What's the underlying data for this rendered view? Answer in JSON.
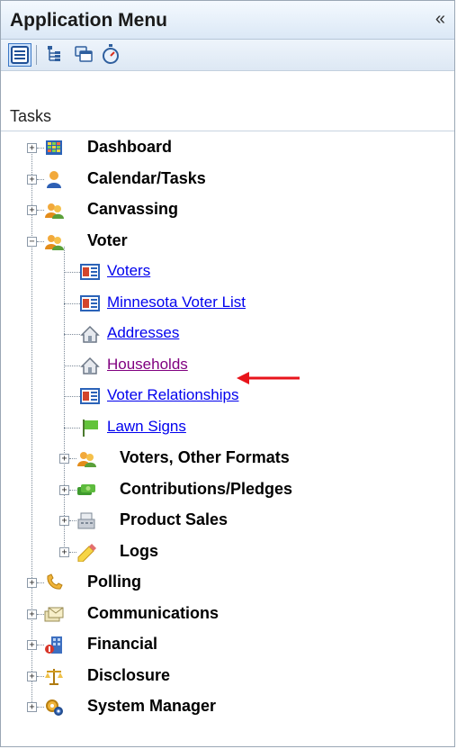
{
  "header": {
    "title": "Application Menu",
    "collapse_glyph": "«"
  },
  "toolbar": {
    "buttons": [
      {
        "icon": "list-view-icon",
        "active": true
      },
      {
        "icon": "tree-view-icon",
        "active": false
      },
      {
        "icon": "windows-icon",
        "active": false
      },
      {
        "icon": "stopwatch-icon",
        "active": false
      }
    ]
  },
  "tasks_label": "Tasks",
  "tree": {
    "items": [
      {
        "label": "Dashboard",
        "icon": "dashboard-icon",
        "level": 0,
        "expanded": false
      },
      {
        "label": "Calendar/Tasks",
        "icon": "person-icon",
        "level": 0,
        "expanded": false
      },
      {
        "label": "Canvassing",
        "icon": "people-icon",
        "level": 0,
        "expanded": false
      },
      {
        "label": "Voter",
        "icon": "people-icon",
        "level": 0,
        "expanded": true
      },
      {
        "label": "Voters",
        "icon": "id-card-icon",
        "level": 1,
        "link": true
      },
      {
        "label": "Minnesota Voter List",
        "icon": "id-card-icon",
        "level": 1,
        "link": true
      },
      {
        "label": "Addresses",
        "icon": "house-icon",
        "level": 1,
        "link": true
      },
      {
        "label": "Households",
        "icon": "house-icon",
        "level": 1,
        "link": true,
        "visited": true
      },
      {
        "label": "Voter Relationships",
        "icon": "id-card-icon",
        "level": 1,
        "link": true
      },
      {
        "label": "Lawn Signs",
        "icon": "flag-icon",
        "level": 1,
        "link": true
      },
      {
        "label": "Voters, Other Formats",
        "icon": "people-icon",
        "level": 1,
        "expanded": false
      },
      {
        "label": "Contributions/Pledges",
        "icon": "money-icon",
        "level": 1,
        "expanded": false
      },
      {
        "label": "Product Sales",
        "icon": "register-icon",
        "level": 1,
        "expanded": false
      },
      {
        "label": "Logs",
        "icon": "pencil-icon",
        "level": 1,
        "expanded": false
      },
      {
        "label": "Polling",
        "icon": "phone-icon",
        "level": 0,
        "expanded": false
      },
      {
        "label": "Communications",
        "icon": "envelopes-icon",
        "level": 0,
        "expanded": false
      },
      {
        "label": "Financial",
        "icon": "building-icon",
        "level": 0,
        "expanded": false
      },
      {
        "label": "Disclosure",
        "icon": "scales-icon",
        "level": 0,
        "expanded": false
      },
      {
        "label": "System Manager",
        "icon": "gears-icon",
        "level": 0,
        "expanded": false
      }
    ]
  },
  "colors": {
    "link": "#0000ee",
    "visited": "#800080",
    "arrow": "#e8141b",
    "header_bg": "#dbe8f6"
  }
}
